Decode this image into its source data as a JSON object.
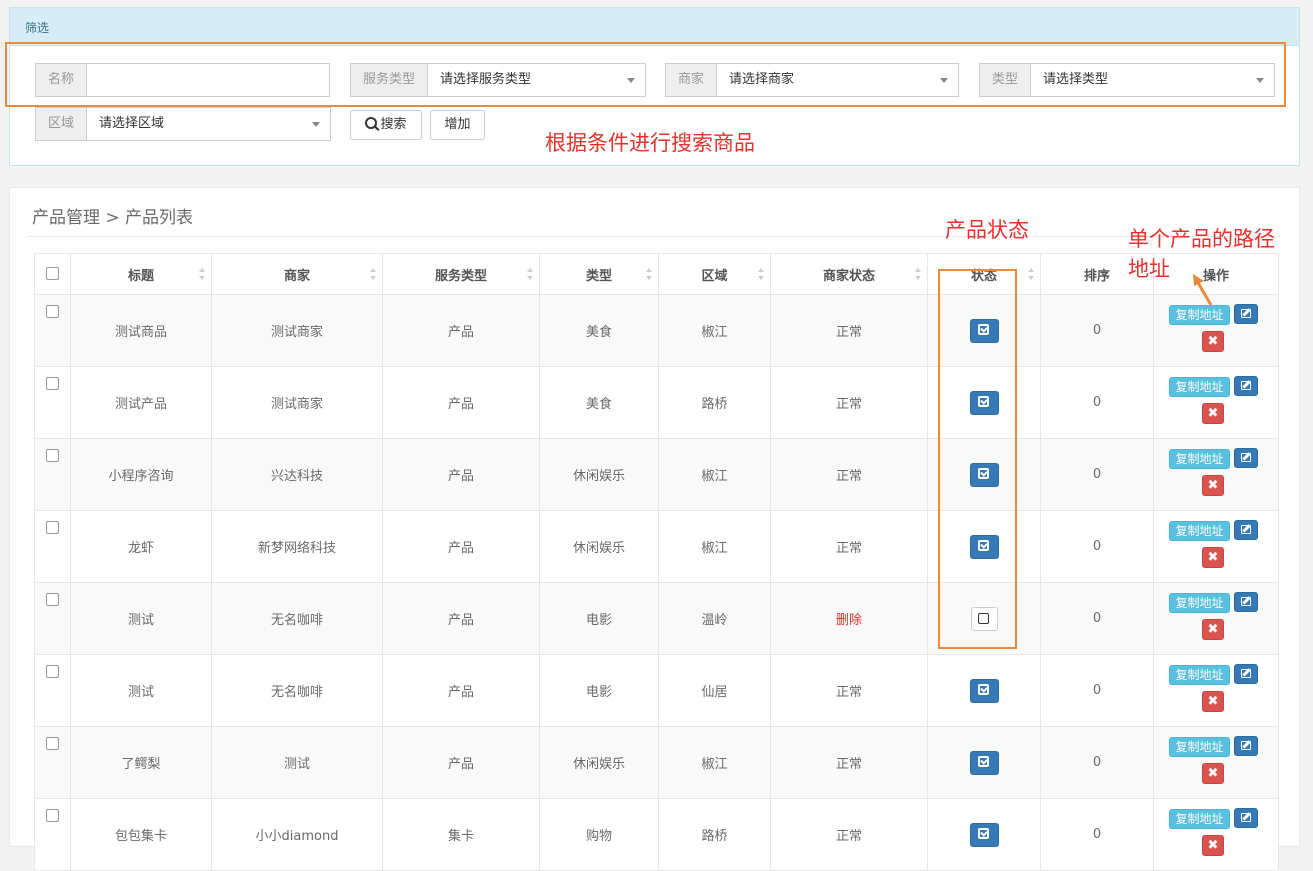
{
  "filter": {
    "heading": "筛选",
    "name_label": "名称",
    "name_value": "",
    "service_type_label": "服务类型",
    "service_type_placeholder": "请选择服务类型",
    "merchant_label": "商家",
    "merchant_placeholder": "请选择商家",
    "type_label": "类型",
    "type_placeholder": "请选择类型",
    "region_label": "区域",
    "region_placeholder": "请选择区域",
    "search_label": "搜索",
    "add_label": "增加"
  },
  "annotations": {
    "search_note": "根据条件进行搜索商品",
    "status_note": "产品状态",
    "path_note_line1": "单个产品的路径",
    "path_note_line2": "地址",
    "highlight_color": "#ec8a3a",
    "note_color": "#e9302a"
  },
  "list": {
    "breadcrumb": "产品管理 > 产品列表",
    "columns": [
      "标题",
      "商家",
      "服务类型",
      "类型",
      "区域",
      "商家状态",
      "状态",
      "排序",
      "操作"
    ],
    "copy_label": "复制地址",
    "rows": [
      {
        "title": "测试商品",
        "merchant": "测试商家",
        "service_type": "产品",
        "type": "美食",
        "region": "椒江",
        "merchant_status": "正常",
        "enabled": true,
        "sort": "0"
      },
      {
        "title": "测试产品",
        "merchant": "测试商家",
        "service_type": "产品",
        "type": "美食",
        "region": "路桥",
        "merchant_status": "正常",
        "enabled": true,
        "sort": "0"
      },
      {
        "title": "小程序咨询",
        "merchant": "兴达科技",
        "service_type": "产品",
        "type": "休闲娱乐",
        "region": "椒江",
        "merchant_status": "正常",
        "enabled": true,
        "sort": "0"
      },
      {
        "title": "龙虾",
        "merchant": "新梦网络科技",
        "service_type": "产品",
        "type": "休闲娱乐",
        "region": "椒江",
        "merchant_status": "正常",
        "enabled": true,
        "sort": "0"
      },
      {
        "title": "测试",
        "merchant": "无名咖啡",
        "service_type": "产品",
        "type": "电影",
        "region": "温岭",
        "merchant_status": "删除",
        "enabled": false,
        "sort": "0"
      },
      {
        "title": "测试",
        "merchant": "无名咖啡",
        "service_type": "产品",
        "type": "电影",
        "region": "仙居",
        "merchant_status": "正常",
        "enabled": true,
        "sort": "0"
      },
      {
        "title": "了鳄梨",
        "merchant": "测试",
        "service_type": "产品",
        "type": "休闲娱乐",
        "region": "椒江",
        "merchant_status": "正常",
        "enabled": true,
        "sort": "0"
      },
      {
        "title": "包包集卡",
        "merchant": "小小diamond",
        "service_type": "集卡",
        "type": "购物",
        "region": "路桥",
        "merchant_status": "正常",
        "enabled": true,
        "sort": "0"
      }
    ]
  }
}
